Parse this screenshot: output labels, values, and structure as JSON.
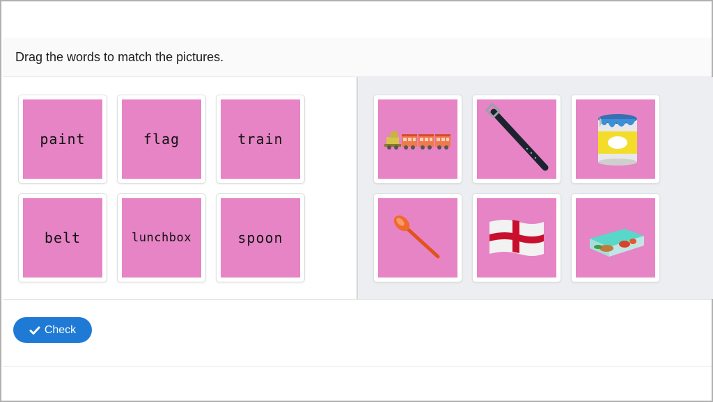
{
  "instructions": "Drag the words to match the pictures.",
  "words": [
    "paint",
    "flag",
    "train",
    "belt",
    "lunchbox",
    "spoon"
  ],
  "pictures": [
    "train-icon",
    "belt-icon",
    "paint-can-icon",
    "spoon-icon",
    "england-flag-icon",
    "lunchbox-icon"
  ],
  "check_button": {
    "label": "Check",
    "icon": "checkmark-icon"
  },
  "colors": {
    "card_fill": "#e684c5",
    "button": "#1f7ad6",
    "right_panel_bg": "#eceef1"
  }
}
